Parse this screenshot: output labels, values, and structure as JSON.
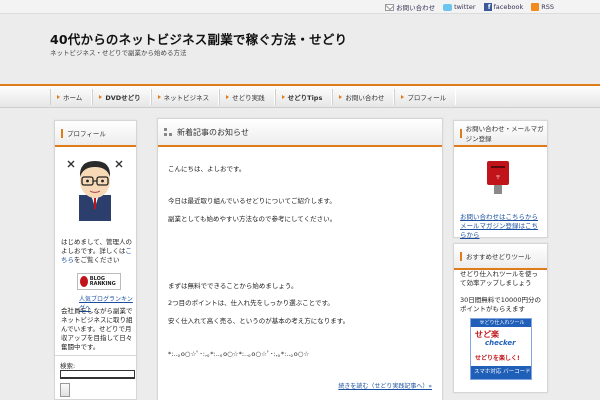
{
  "topbar": {
    "mail_label": "お問い合わせ",
    "twitter_label": "twitter",
    "facebook_label": "facebook",
    "rss_label": "RSS"
  },
  "header": {
    "title": "40代からのネットビジネス副業で稼ぐ方法・せどり",
    "description": "ネットビジネス・せどりで副業から始める方法"
  },
  "nav": {
    "items": [
      {
        "label": "ホーム"
      },
      {
        "label": "DVDせどり"
      },
      {
        "label": "ネットビジネス"
      },
      {
        "label": "せどり実践"
      },
      {
        "label": "せどりTips"
      },
      {
        "label": "お問い合わせ"
      },
      {
        "label": "プロフィール"
      }
    ]
  },
  "left": {
    "heading": "プロフィール",
    "text1": "はじめまして、管理人の",
    "text1b": "よしおです。詳しくは",
    "text1_link": "こちら",
    "text1c": "をご覧ください",
    "badge": "BLOG RANKING",
    "link": "人気ブログランキングへ",
    "text2": "会社員をしながら副業でネットビジネスに取り組んでいます。せどりで月収アップを目指して日々奮闘中です。",
    "search_label": "検索:",
    "search_value": ""
  },
  "main": {
    "heading": "新着記事のお知らせ",
    "lines": [
      "こんにちは、よしおです。",
      "今日は最近取り組んでいるせどりについてご紹介します。",
      "副業としても始めやすい方法なので参考にしてください。",
      "まずは無料でできることから始めましょう。",
      "2つ目のポイントは、仕入れ先をしっかり選ぶことです。",
      "安く仕入れて高く売る、というのが基本の考え方になります。",
      "*:..｡o○☆ﾟ･:,｡*:..｡o○☆*:..｡o○☆ﾟ･:,｡*:..｡o○☆"
    ],
    "more_link": "続きを読む（せどり実践記事へ）»"
  },
  "right": {
    "heading": "お問い合わせ・メールマガジン登録",
    "link": "お問い合わせはこちらから メールマガジン登録はこちらから"
  },
  "right2": {
    "heading": "おすすめせどりツール",
    "text1": "せどり仕入れツールを使って効率アップしましょう",
    "text2": "30日間無料で10000円分のポイントがもらえます",
    "banner_top": "せどり仕入れツール",
    "banner_logo": "せど楽",
    "banner_logo2": "checker",
    "banner_sub": "せどりを楽しく!",
    "banner_bottom": "スマホ対応 バーコード"
  },
  "colors": {
    "accent": "#e07b1a",
    "link": "#1a4fa0",
    "post_red": "#c0141a"
  }
}
